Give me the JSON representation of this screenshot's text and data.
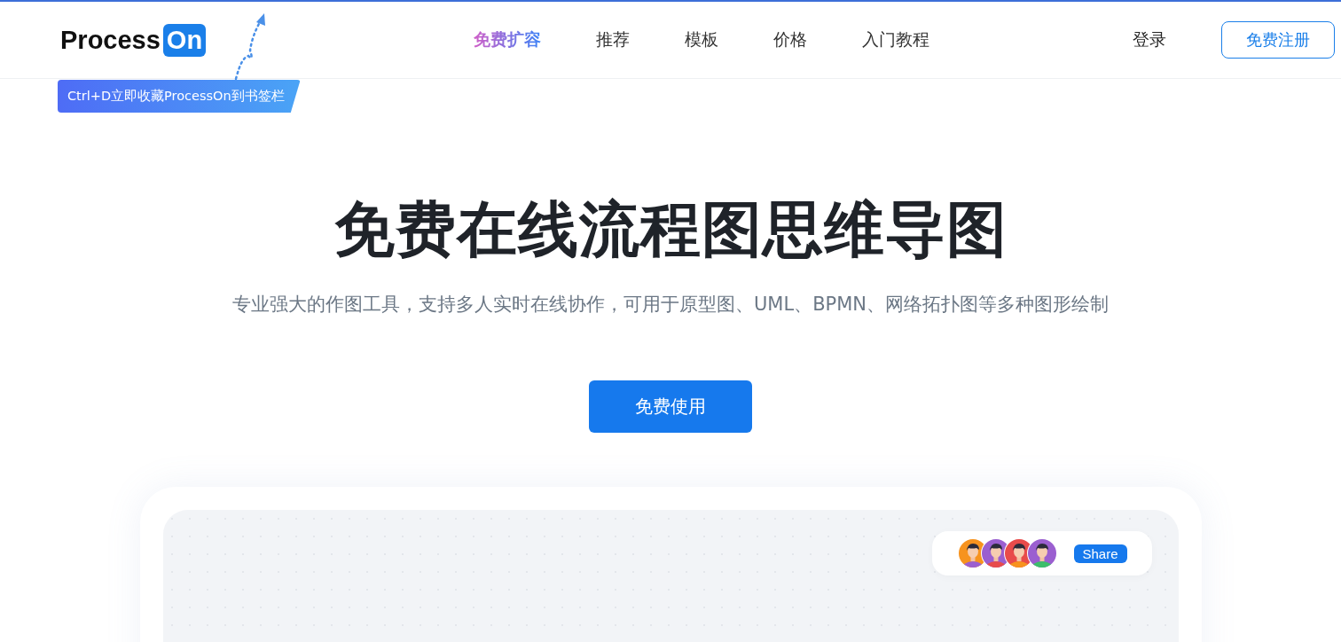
{
  "header": {
    "logo": {
      "text": "Process",
      "badge": "On"
    },
    "nav": [
      {
        "label": "免费扩容",
        "highlighted": true
      },
      {
        "label": "推荐",
        "highlighted": false
      },
      {
        "label": "模板",
        "highlighted": false
      },
      {
        "label": "价格",
        "highlighted": false
      },
      {
        "label": "入门教程",
        "highlighted": false
      }
    ],
    "login": "登录",
    "register": "免费注册"
  },
  "bookmark_tip": "Ctrl+D立即收藏ProcessOn到书签栏",
  "hero": {
    "title": "免费在线流程图思维导图",
    "subtitle": "专业强大的作图工具，支持多人实时在线协作，可用于原型图、UML、BPMN、网络拓扑图等多种图形绘制",
    "cta": "免费使用"
  },
  "preview": {
    "avatars": [
      {
        "color": "#f7931e"
      },
      {
        "color": "#9b5fd0"
      },
      {
        "color": "#e84b4b"
      },
      {
        "color": "#9b5fd0"
      }
    ],
    "share": "Share"
  }
}
